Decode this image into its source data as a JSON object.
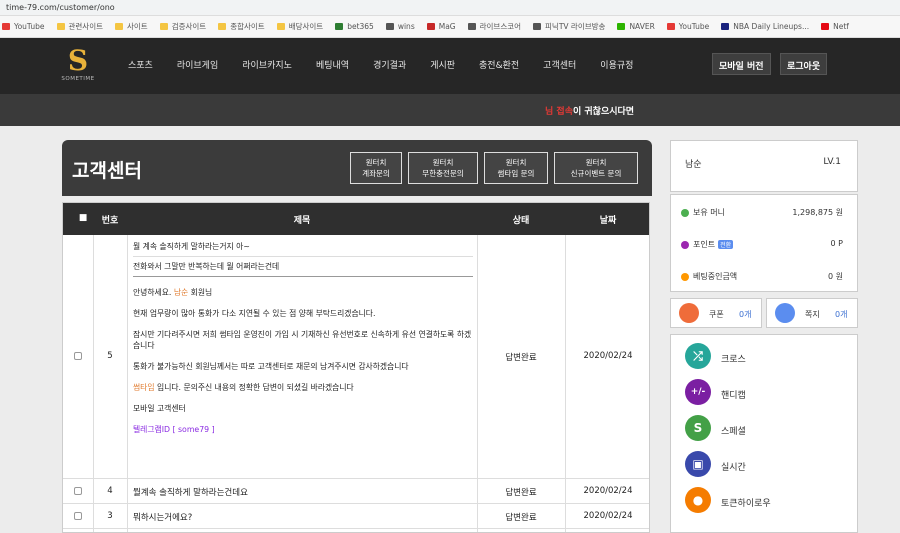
{
  "browser": {
    "url": "time-79.com/customer/ono",
    "bookmarks": [
      {
        "label": "YouTube",
        "color": "#e53935"
      },
      {
        "label": "관련사이트",
        "color": "#f4c542"
      },
      {
        "label": "사이트",
        "color": "#f4c542"
      },
      {
        "label": "검증사이트",
        "color": "#f4c542"
      },
      {
        "label": "종합사이트",
        "color": "#f4c542"
      },
      {
        "label": "배당사이트",
        "color": "#f4c542"
      },
      {
        "label": "bet365",
        "color": "#2e7d32"
      },
      {
        "label": "wins",
        "color": "#555555"
      },
      {
        "label": "MaG",
        "color": "#c62828"
      },
      {
        "label": "라이브스코어",
        "color": "#555555"
      },
      {
        "label": "피닉TV 라이브방송",
        "color": "#555555"
      },
      {
        "label": "NAVER",
        "color": "#2db400"
      },
      {
        "label": "YouTube",
        "color": "#e53935"
      },
      {
        "label": "NBA Daily Lineups...",
        "color": "#1a237e"
      },
      {
        "label": "Netf",
        "color": "#e50914"
      }
    ]
  },
  "header": {
    "logo_text": "SOMETIME",
    "nav": [
      "스포츠",
      "라이브게임",
      "라이브카지노",
      "베팅내역",
      "경기결과",
      "게시판",
      "충전&환전",
      "고객센터",
      "이용규정"
    ],
    "mobile_label": "모바일 버전",
    "logout_label": "로그아웃",
    "notice_highlight": "님 접속",
    "notice_text": "이 귀찮으시다면"
  },
  "panel": {
    "title": "고객센터",
    "buttons": [
      {
        "line1": "원터치",
        "line2": "계좌문의"
      },
      {
        "line1": "원터치",
        "line2": "무한충전문의"
      },
      {
        "line1": "원터치",
        "line2": "썸타임 문의"
      },
      {
        "line1": "원터치",
        "line2": "신규이벤트 문의"
      }
    ]
  },
  "table": {
    "headers": {
      "check": "■",
      "no": "번호",
      "title": "제목",
      "status": "상태",
      "date": "날짜"
    },
    "expanded": {
      "no": "5",
      "title": "뭘 계속 솔직하게 말하라는거지 아~",
      "sub": "전화와서 그말만 반복하는데 뭘 어쩌라는건데",
      "greeting_pre": "안녕하세요.",
      "greeting_name": "남순",
      "greeting_post": "회원님",
      "p1": "현재 업무량이 많아 통화가 다소 지연될 수 있는 점 양해 부탁드리겠습니다.",
      "p2": "잠시만 기다려주시면 저희 썸타임 운영진이 가입 시 기재하신 유선번호로 신속하게 유선 연결하도록 하겠습니다",
      "p3": "통화가 불가능하신 회원님께서는 따로 고객센터로 재문의 남겨주시면 감사하겠습니다",
      "sig_brand": "썸타임",
      "sig_text": "입니다. 문의주신 내용의 정확한 답변이 되셨길 바라겠습니다",
      "sig_team": "모바일 고객센터",
      "telegram": "텔레그램ID [ some79 ]",
      "status": "답변완료",
      "date": "2020/02/24"
    },
    "rows": [
      {
        "no": "4",
        "title": "뭘계속 솔직하게 말하라는건데요",
        "status": "답변완료",
        "date": "2020/02/24"
      },
      {
        "no": "3",
        "title": "뭐하시는거에요?",
        "status": "답변완료",
        "date": "2020/02/24"
      }
    ]
  },
  "sidebar": {
    "username": "남순",
    "level": "LV.1",
    "money": [
      {
        "label": "보유 머니",
        "value": "1,298,875 원",
        "color": "#4caf50"
      },
      {
        "label": "포인트",
        "tag": "전환",
        "value": "0 P",
        "color": "#9c27b0"
      },
      {
        "label": "베팅중인금액",
        "value": "0 원",
        "color": "#ff9800"
      }
    ],
    "coupon": {
      "label": "쿠폰",
      "count": "0개"
    },
    "message": {
      "label": "쪽지",
      "count": "0개"
    },
    "games": [
      {
        "label": "크로스",
        "icon": "cross-icon",
        "glyph": "⤮",
        "color": "#26a69a"
      },
      {
        "label": "핸디캡",
        "icon": "handicap-icon",
        "glyph": "+/-",
        "color": "#7b1fa2"
      },
      {
        "label": "스페셜",
        "icon": "special-icon",
        "glyph": "S",
        "color": "#43a047"
      },
      {
        "label": "실시간",
        "icon": "live-icon",
        "glyph": "▣",
        "color": "#3949ab"
      },
      {
        "label": "토큰하이로우",
        "icon": "token-icon",
        "glyph": "●",
        "color": "#f57c00"
      }
    ]
  }
}
